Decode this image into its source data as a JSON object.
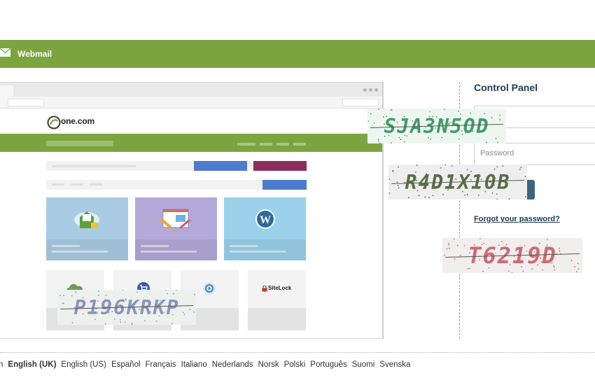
{
  "header": {
    "webmail_label": "Webmail",
    "icon": "envelope-icon"
  },
  "illustration": {
    "brand": "one.com",
    "tiles": [
      {
        "color": "#a9cbe3",
        "icon": "email-cloud-icon"
      },
      {
        "color": "#b3a9d9",
        "icon": "website-builder-icon"
      },
      {
        "color": "#9bd1ea",
        "icon": "wordpress-icon"
      }
    ],
    "cards": [
      {
        "icon": "backup-icon"
      },
      {
        "icon": "shop-cart-icon"
      },
      {
        "icon": "gear-icon"
      },
      {
        "icon": "sitelock-icon",
        "text": "SiteLock"
      }
    ]
  },
  "captchas": [
    {
      "text": "SJA3N5OD",
      "bg": "#eef7ef",
      "fg": "#3f9c6b"
    },
    {
      "text": "R4D1X10B",
      "bg": "#efeeee",
      "fg": "#5a6d46"
    },
    {
      "text": "T6219D",
      "bg": "#f1eeee",
      "fg": "#d06a72"
    },
    {
      "text": "P196KRKP",
      "bg": "#edf1ee",
      "fg": "#8a95b8"
    }
  ],
  "login": {
    "title": "Control Panel",
    "password_placeholder": "Password",
    "forgot_label": "Forgot your password?"
  },
  "footer": {
    "languages": [
      {
        "label": "n",
        "active": false
      },
      {
        "label": "English (UK)",
        "active": true
      },
      {
        "label": "English (US)",
        "active": false
      },
      {
        "label": "Español",
        "active": false
      },
      {
        "label": "Français",
        "active": false
      },
      {
        "label": "Italiano",
        "active": false
      },
      {
        "label": "Nederlands",
        "active": false
      },
      {
        "label": "Norsk",
        "active": false
      },
      {
        "label": "Polski",
        "active": false
      },
      {
        "label": "Português",
        "active": false
      },
      {
        "label": "Suomi",
        "active": false
      },
      {
        "label": "Svenska",
        "active": false
      }
    ]
  }
}
